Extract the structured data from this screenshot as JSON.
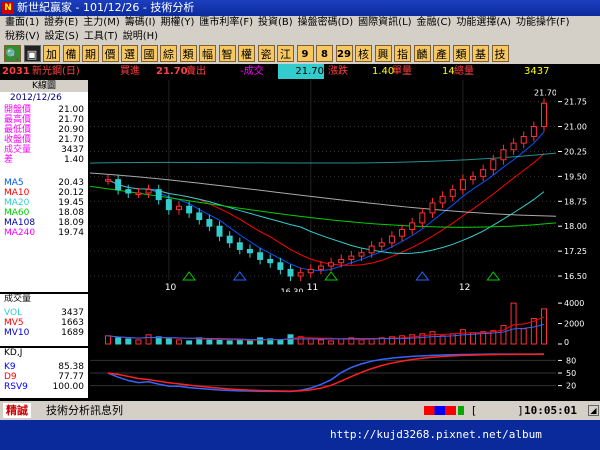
{
  "window": {
    "title": "新世紀贏家 - 101/12/26 - 技術分析",
    "app_icon": "N"
  },
  "menu": {
    "row1": [
      "畫面(1)",
      "證券(E)",
      "主力(M)",
      "籌碼(I)",
      "期權(Y)",
      "匯市利率(F)",
      "投資(B)",
      "操盤密碼(D)",
      "國際資訊(L)",
      "金融(C)",
      "功能選擇(A)",
      "功能操作(F)"
    ],
    "row2": [
      "稅務(V)",
      "設定(S)",
      "工具(T)",
      "說明(H)"
    ]
  },
  "toolbar": {
    "buttons": [
      {
        "label": "🔍",
        "kind": "grn",
        "name": "search-icon"
      },
      {
        "label": "▣",
        "kind": "blk",
        "name": "window-icon"
      },
      {
        "label": "加",
        "kind": "yel"
      },
      {
        "label": "備",
        "kind": "yel"
      },
      {
        "label": "期",
        "kind": "yel"
      },
      {
        "label": "價",
        "kind": "yel"
      },
      {
        "label": "選",
        "kind": "yel"
      },
      {
        "label": "國",
        "kind": "yel"
      },
      {
        "label": "綜",
        "kind": "yel"
      },
      {
        "label": "類",
        "kind": "yel"
      },
      {
        "label": "幅",
        "kind": "yel"
      },
      {
        "label": "智",
        "kind": "yel"
      },
      {
        "label": "權",
        "kind": "yel"
      },
      {
        "label": "瓷",
        "kind": "yel"
      },
      {
        "label": "江",
        "kind": "yel"
      },
      {
        "label": "9",
        "kind": "num"
      },
      {
        "label": "8",
        "kind": "num"
      },
      {
        "label": "29",
        "kind": "num"
      },
      {
        "label": "核",
        "kind": "yel"
      },
      {
        "label": "興",
        "kind": "yel"
      },
      {
        "label": "指",
        "kind": "yel"
      },
      {
        "label": "麟",
        "kind": "yel"
      },
      {
        "label": "產",
        "kind": "yel"
      },
      {
        "label": "類",
        "kind": "yel"
      },
      {
        "label": "基",
        "kind": "yel"
      },
      {
        "label": "技",
        "kind": "yel"
      }
    ]
  },
  "quote": {
    "code": "2031",
    "name": "新光鋼(日)",
    "bid_label": "買進",
    "bid": "21.70",
    "ask_label": "賣出",
    "change_label": "-成交",
    "last": "21.70",
    "chg_label": "漲跌",
    "chg": "1.40",
    "unit_label": "單量",
    "unit": "14",
    "vol_label": "總量",
    "vol": "3437"
  },
  "kline_panel": {
    "header": "K線圖",
    "date": "2012/12/26",
    "fields": [
      {
        "label": "開盤價",
        "value": "21.00"
      },
      {
        "label": "最高價",
        "value": "21.70"
      },
      {
        "label": "最低價",
        "value": "20.90"
      },
      {
        "label": "收盤價",
        "value": "21.70"
      },
      {
        "label": "成交量",
        "value": "3437"
      },
      {
        "label": "差",
        "value": "1.40"
      }
    ],
    "ma": [
      {
        "label": "MA5",
        "value": "20.43",
        "color": "#0055ff"
      },
      {
        "label": "MA10",
        "value": "20.12",
        "color": "#ff0000"
      },
      {
        "label": "MA20",
        "value": "19.45",
        "color": "#33cccc"
      },
      {
        "label": "MA60",
        "value": "18.08",
        "color": "#00cc00"
      },
      {
        "label": "MA108",
        "value": "18.09",
        "color": "#0000aa"
      },
      {
        "label": "MA240",
        "value": "19.74",
        "color": "#ff00ff"
      }
    ]
  },
  "volume_panel": {
    "header": "成交量",
    "fields": [
      {
        "label": "VOL",
        "value": "3437",
        "color": "#33cccc"
      },
      {
        "label": "MV5",
        "value": "1663",
        "color": "#ff0000"
      },
      {
        "label": "MV10",
        "value": "1689",
        "color": "#0000cc"
      }
    ]
  },
  "kd_panel": {
    "header": "KD,J",
    "fields": [
      {
        "label": "K9",
        "value": "85.38",
        "color": "#0000ff"
      },
      {
        "label": "D9",
        "value": "77.77",
        "color": "#ff0000"
      },
      {
        "label": "RSV9",
        "value": "100.00",
        "color": "#0000ff"
      }
    ]
  },
  "price_axis": {
    "ticks": [
      "21.75",
      "21.00",
      "20.25",
      "19.50",
      "18.75",
      "18.00",
      "17.25",
      "16.50"
    ],
    "high_label": "21.70",
    "low_label": "16.30"
  },
  "volume_axis": {
    "ticks": [
      "4000",
      "2000",
      "0"
    ]
  },
  "kd_axis": {
    "ticks": [
      "80",
      "50",
      "20"
    ]
  },
  "months": [
    "10",
    "11",
    "12"
  ],
  "status": {
    "left_badge": "精誠",
    "message": "技術分析訊息列",
    "bracket": "[",
    "close_bracket": "]",
    "time": "10:05:01"
  },
  "taskbar": {
    "url": "http://kujd3268.pixnet.net/album"
  },
  "chart_data": {
    "type": "candlestick",
    "close": [
      19.4,
      19.1,
      19.0,
      19.0,
      19.1,
      18.8,
      18.5,
      18.6,
      18.4,
      18.2,
      18.0,
      17.7,
      17.5,
      17.3,
      17.2,
      17.0,
      16.9,
      16.7,
      16.5,
      16.6,
      16.7,
      16.8,
      16.9,
      17.0,
      17.1,
      17.2,
      17.4,
      17.5,
      17.7,
      17.9,
      18.1,
      18.4,
      18.7,
      18.9,
      19.1,
      19.4,
      19.5,
      19.7,
      20.0,
      20.3,
      20.5,
      20.7,
      21.0,
      21.7
    ]
  }
}
